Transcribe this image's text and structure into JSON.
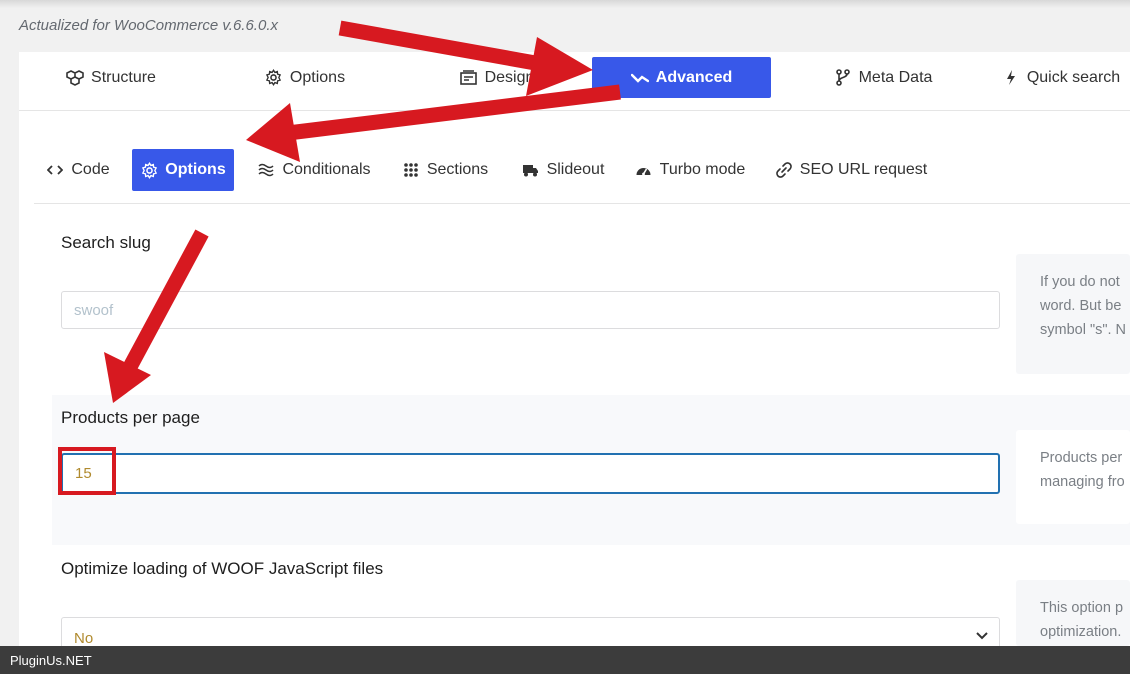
{
  "header": {
    "version_text": "Actualized for WooCommerce v.6.6.0.x"
  },
  "main_tabs": [
    {
      "label": "Structure",
      "icon": "cubes-icon"
    },
    {
      "label": "Options",
      "icon": "gear-icon"
    },
    {
      "label": "Design",
      "icon": "design-icon"
    },
    {
      "label": "Advanced",
      "icon": "advanced-icon"
    },
    {
      "label": "Meta Data",
      "icon": "meta-data-icon"
    },
    {
      "label": "Quick search",
      "icon": "lightning-icon"
    }
  ],
  "main_tab_active": "Advanced",
  "sub_tabs": [
    {
      "label": "Code",
      "icon": "code-icon"
    },
    {
      "label": "Options",
      "icon": "gear-icon"
    },
    {
      "label": "Conditionals",
      "icon": "wave-icon"
    },
    {
      "label": "Sections",
      "icon": "grid-icon"
    },
    {
      "label": "Slideout",
      "icon": "truck-icon"
    },
    {
      "label": "Turbo mode",
      "icon": "speedometer-icon"
    },
    {
      "label": "SEO URL request",
      "icon": "link-icon"
    }
  ],
  "sub_tab_active": "Options",
  "fields": {
    "search_slug": {
      "label": "Search slug",
      "placeholder": "swoof",
      "value": "",
      "help_lines": [
        "If you do not",
        "word. But be",
        "symbol \"s\". N"
      ]
    },
    "products_per_page": {
      "label": "Products per page",
      "value": "15",
      "help_lines": [
        "Products per",
        "managing fro"
      ]
    },
    "optimize_js": {
      "label": "Optimize loading of WOOF JavaScript files",
      "selected": "No",
      "help_lines": [
        "This option p",
        "optimization."
      ]
    }
  },
  "footer": {
    "text": "PluginUs.NET"
  },
  "colors": {
    "accent": "#3858e9",
    "annotation_red": "#d71920",
    "focus_border": "#2271b1"
  }
}
